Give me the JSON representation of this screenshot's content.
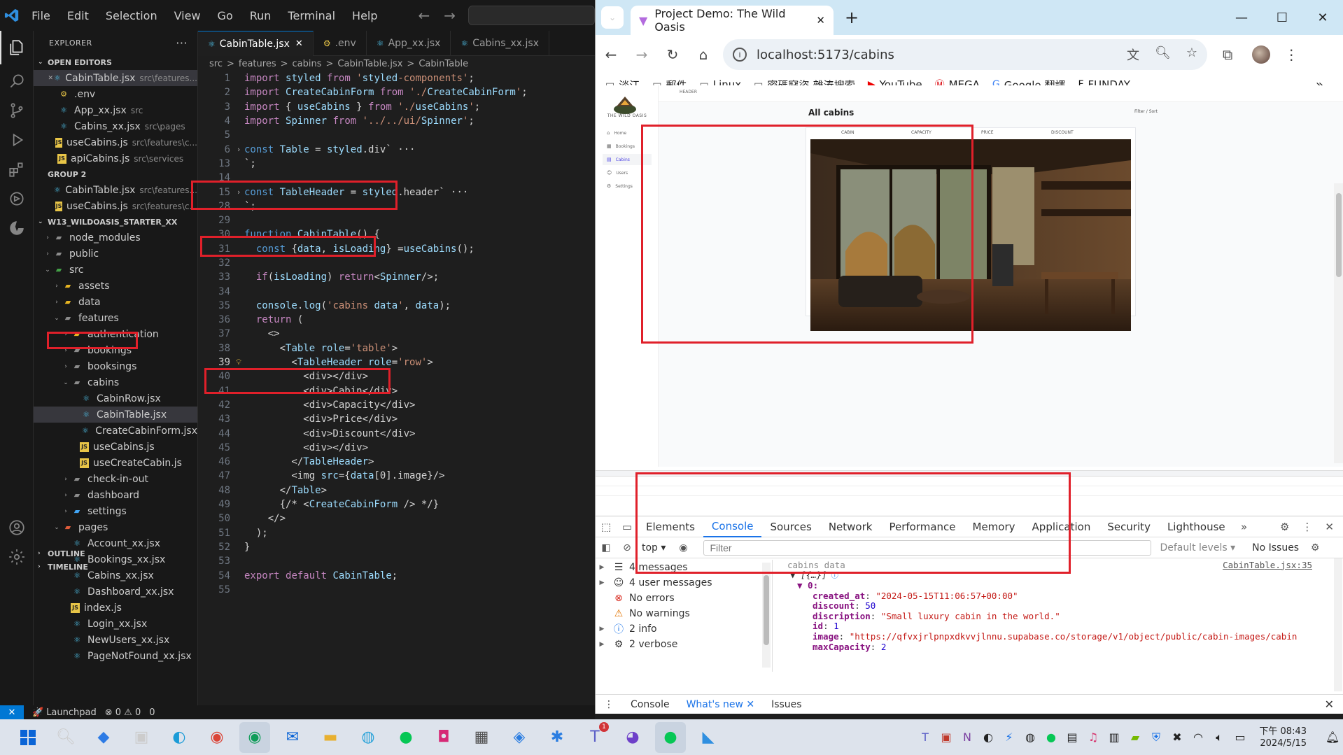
{
  "vscode": {
    "menu": [
      "File",
      "Edit",
      "Selection",
      "View",
      "Go",
      "Run",
      "Terminal",
      "Help"
    ],
    "explorer_title": "EXPLORER",
    "sections": {
      "open_editors": "OPEN EDITORS",
      "group2": "GROUP 2",
      "project": "W13_WILDOASIS_STARTER_XX",
      "outline": "OUTLINE",
      "timeline": "TIMELINE"
    },
    "open_editors": [
      {
        "name": "CabinTable.jsx",
        "path": "src\\features...",
        "icon": "react-icon",
        "close": true,
        "selected": true
      },
      {
        "name": ".env",
        "path": "",
        "icon": "env-icon"
      },
      {
        "name": "App_xx.jsx",
        "path": "src",
        "icon": "react-icon"
      },
      {
        "name": "Cabins_xx.jsx",
        "path": "src\\pages",
        "icon": "react-icon"
      },
      {
        "name": "useCabins.js",
        "path": "src\\features\\c...",
        "icon": "js-icon"
      },
      {
        "name": "apiCabins.js",
        "path": "src\\services",
        "icon": "js-icon"
      }
    ],
    "group2": [
      {
        "name": "CabinTable.jsx",
        "path": "src\\features...",
        "icon": "react-icon"
      },
      {
        "name": "useCabins.js",
        "path": "src\\features\\c...",
        "icon": "js-icon"
      }
    ],
    "tree": [
      {
        "name": "node_modules",
        "depth": 1,
        "chev": "›",
        "icon": "folder-icon"
      },
      {
        "name": "public",
        "depth": 1,
        "chev": "›",
        "icon": "folder-icon"
      },
      {
        "name": "src",
        "depth": 1,
        "chev": "⌄",
        "icon": "folder-green-icon"
      },
      {
        "name": "assets",
        "depth": 2,
        "chev": "›",
        "icon": "folder-yellow-icon"
      },
      {
        "name": "data",
        "depth": 2,
        "chev": "›",
        "icon": "folder-yellow-icon"
      },
      {
        "name": "features",
        "depth": 2,
        "chev": "⌄",
        "icon": "folder-icon"
      },
      {
        "name": "authentication",
        "depth": 3,
        "chev": "›",
        "icon": "folder-yellow-icon"
      },
      {
        "name": "bookings",
        "depth": 3,
        "chev": "›",
        "icon": "folder-icon"
      },
      {
        "name": "booksings",
        "depth": 3,
        "chev": "›",
        "icon": "folder-icon"
      },
      {
        "name": "cabins",
        "depth": 3,
        "chev": "⌄",
        "icon": "folder-icon"
      },
      {
        "name": "CabinRow.jsx",
        "depth": 4,
        "chev": "",
        "icon": "react-icon"
      },
      {
        "name": "CabinTable.jsx",
        "depth": 4,
        "chev": "",
        "icon": "react-icon",
        "selected": true
      },
      {
        "name": "CreateCabinForm.jsx",
        "depth": 4,
        "chev": "",
        "icon": "react-icon"
      },
      {
        "name": "useCabins.js",
        "depth": 4,
        "chev": "",
        "icon": "js-icon"
      },
      {
        "name": "useCreateCabin.js",
        "depth": 4,
        "chev": "",
        "icon": "js-icon"
      },
      {
        "name": "check-in-out",
        "depth": 3,
        "chev": "›",
        "icon": "folder-icon"
      },
      {
        "name": "dashboard",
        "depth": 3,
        "chev": "›",
        "icon": "folder-icon"
      },
      {
        "name": "settings",
        "depth": 3,
        "chev": "›",
        "icon": "folder-blue-icon"
      },
      {
        "name": "pages",
        "depth": 2,
        "chev": "⌄",
        "icon": "folder-red-icon"
      },
      {
        "name": "Account_xx.jsx",
        "depth": 3,
        "chev": "",
        "icon": "react-icon"
      },
      {
        "name": "Bookings_xx.jsx",
        "depth": 3,
        "chev": "",
        "icon": "react-icon"
      },
      {
        "name": "Cabins_xx.jsx",
        "depth": 3,
        "chev": "",
        "icon": "react-icon"
      },
      {
        "name": "Dashboard_xx.jsx",
        "depth": 3,
        "chev": "",
        "icon": "react-icon"
      },
      {
        "name": "index.js",
        "depth": 3,
        "chev": "",
        "icon": "js-icon"
      },
      {
        "name": "Login_xx.jsx",
        "depth": 3,
        "chev": "",
        "icon": "react-icon"
      },
      {
        "name": "NewUsers_xx.jsx",
        "depth": 3,
        "chev": "",
        "icon": "react-icon"
      },
      {
        "name": "PageNotFound_xx.jsx",
        "depth": 3,
        "chev": "",
        "icon": "react-icon"
      }
    ],
    "tabs": [
      {
        "label": "CabinTable.jsx",
        "icon": "react-icon",
        "active": true
      },
      {
        "label": ".env",
        "icon": "env-icon"
      },
      {
        "label": "App_xx.jsx",
        "icon": "react-icon"
      },
      {
        "label": "Cabins_xx.jsx",
        "icon": "react-icon"
      }
    ],
    "breadcrumb": [
      "src",
      ">",
      "features",
      ">",
      "cabins",
      ">",
      "CabinTable.jsx",
      ">",
      "CabinTable"
    ],
    "code": [
      {
        "n": "1",
        "t": "import styled from 'styled-components';"
      },
      {
        "n": "2",
        "t": "import CreateCabinForm from './CreateCabinForm';"
      },
      {
        "n": "3",
        "t": "import { useCabins } from './useCabins';"
      },
      {
        "n": "4",
        "t": "import Spinner from '../../ui/Spinner';"
      },
      {
        "n": "5",
        "t": ""
      },
      {
        "n": "6",
        "t": "const Table = styled.div` ···",
        "fold": "›"
      },
      {
        "n": "13",
        "t": "`;"
      },
      {
        "n": "14",
        "t": ""
      },
      {
        "n": "15",
        "t": "const TableHeader = styled.header` ···",
        "fold": "›"
      },
      {
        "n": "28",
        "t": "`;"
      },
      {
        "n": "29",
        "t": ""
      },
      {
        "n": "30",
        "t": "function CabinTable() {"
      },
      {
        "n": "31",
        "t": "  const {data, isLoading} =useCabins();"
      },
      {
        "n": "32",
        "t": ""
      },
      {
        "n": "33",
        "t": "  if(isLoading) return<Spinner/>;"
      },
      {
        "n": "34",
        "t": ""
      },
      {
        "n": "35",
        "t": "  console.log('cabins data', data);"
      },
      {
        "n": "36",
        "t": "  return ("
      },
      {
        "n": "37",
        "t": "    <>"
      },
      {
        "n": "38",
        "t": "      <Table role='table'>"
      },
      {
        "n": "39",
        "t": "        <TableHeader role='row'>",
        "bulb": true,
        "cur": true
      },
      {
        "n": "40",
        "t": "          <div></div>"
      },
      {
        "n": "41",
        "t": "          <div>Cabin</div>"
      },
      {
        "n": "42",
        "t": "          <div>Capacity</div>"
      },
      {
        "n": "43",
        "t": "          <div>Price</div>"
      },
      {
        "n": "44",
        "t": "          <div>Discount</div>"
      },
      {
        "n": "45",
        "t": "          <div></div>"
      },
      {
        "n": "46",
        "t": "        </TableHeader>"
      },
      {
        "n": "47",
        "t": "        <img src={data[0].image}/>"
      },
      {
        "n": "48",
        "t": "      </Table>"
      },
      {
        "n": "49",
        "t": "      {/* <CreateCabinForm /> */}"
      },
      {
        "n": "50",
        "t": "    </>"
      },
      {
        "n": "51",
        "t": "  );"
      },
      {
        "n": "52",
        "t": "}"
      },
      {
        "n": "53",
        "t": ""
      },
      {
        "n": "54",
        "t": "export default CabinTable;"
      },
      {
        "n": "55",
        "t": ""
      }
    ],
    "status": {
      "launchpad": "Launchpad",
      "problems": "⊗ 0 ⚠ 0",
      "ports": "0"
    }
  },
  "chrome": {
    "tab_title": "Project Demo: The Wild Oasis",
    "url": "localhost:5173/cabins",
    "bookmarks": [
      {
        "label": "淡江",
        "icon": "folder-icon"
      },
      {
        "label": "郵件",
        "icon": "folder-icon"
      },
      {
        "label": "Linux",
        "icon": "folder-icon"
      },
      {
        "label": "密碼竊盜-雜湊搜索",
        "icon": "folder-icon"
      },
      {
        "label": "YouTube",
        "icon": "youtube-icon"
      },
      {
        "label": "MEGA",
        "icon": "mega-icon"
      },
      {
        "label": "Google 翻譯",
        "icon": "translate-icon"
      },
      {
        "label": "FUNDAY",
        "icon": "funday-icon"
      }
    ]
  },
  "app": {
    "brand": "THE WILD OASIS",
    "header": "HEADER",
    "nav": [
      {
        "label": "Home",
        "icon": "home-icon"
      },
      {
        "label": "Bookings",
        "icon": "calendar-icon"
      },
      {
        "label": "Cabins",
        "icon": "cabin-icon",
        "active": true
      },
      {
        "label": "Users",
        "icon": "users-icon"
      },
      {
        "label": "Settings",
        "icon": "settings-icon"
      }
    ],
    "title": "All cabins",
    "ops": "Filter / Sort",
    "table_headers": [
      "CABIN",
      "CAPACITY",
      "PRICE",
      "DISCOUNT"
    ]
  },
  "devtools": {
    "tabs": [
      "Elements",
      "Console",
      "Sources",
      "Network",
      "Performance",
      "Memory",
      "Application",
      "Security",
      "Lighthouse"
    ],
    "active_tab": "Console",
    "context": "top",
    "filter_placeholder": "Filter",
    "levels": "Default levels ▾",
    "issues": "No Issues",
    "sidebar": [
      {
        "label": "4 messages",
        "icon": "list-icon",
        "chev": true
      },
      {
        "label": "4 user messages",
        "icon": "user-icon",
        "chev": true
      },
      {
        "label": "No errors",
        "icon": "error-icon",
        "chev": false
      },
      {
        "label": "No warnings",
        "icon": "warning-icon",
        "chev": false
      },
      {
        "label": "2 info",
        "icon": "info-icon",
        "chev": true
      },
      {
        "label": "2 verbose",
        "icon": "bug-icon",
        "chev": true
      }
    ],
    "log": {
      "header": "cabins data",
      "source": "CabinTable.jsx:35",
      "array": "▼ [{…}]",
      "index": "▼ 0:",
      "fields": [
        {
          "k": "created_at",
          "v": "\"2024-05-15T11:06:57+00:00\"",
          "type": "str"
        },
        {
          "k": "discount",
          "v": "50",
          "type": "num"
        },
        {
          "k": "discription",
          "v": "\"Small luxury cabin in the world.\"",
          "type": "str"
        },
        {
          "k": "id",
          "v": "1",
          "type": "num"
        },
        {
          "k": "image",
          "v": "\"https://qfvxjrlpnpxdkvvjlnnu.supabase.co/storage/v1/object/public/cabin-images/cabin",
          "type": "str"
        },
        {
          "k": "maxCapacity",
          "v": "2",
          "type": "num"
        }
      ]
    },
    "drawer": [
      "Console",
      "What's new ✕",
      "Issues"
    ]
  },
  "taskbar": {
    "time": "下午 08:43",
    "date": "2024/5/15",
    "badge": "1"
  }
}
